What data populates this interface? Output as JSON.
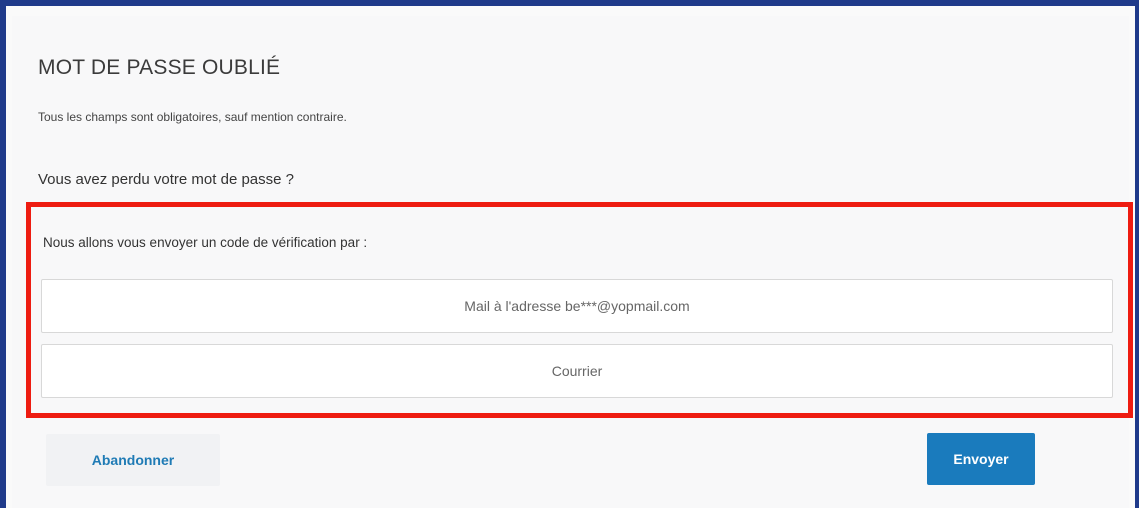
{
  "page": {
    "title": "MOT DE PASSE OUBLIÉ",
    "required_note": "Tous les champs sont obligatoires, sauf mention contraire.",
    "question": "Vous avez perdu votre mot de passe ?"
  },
  "verification": {
    "instruction": "Nous allons vous envoyer un code de vérification par :",
    "options": [
      {
        "label": "Mail à l'adresse be***@yopmail.com"
      },
      {
        "label": "Courrier"
      }
    ]
  },
  "actions": {
    "cancel_label": "Abandonner",
    "send_label": "Envoyer"
  },
  "colors": {
    "frame_border": "#1f3a8a",
    "highlight_border": "#ee1c11",
    "primary_button": "#1a7bbd",
    "link_text": "#1f7bb5"
  }
}
